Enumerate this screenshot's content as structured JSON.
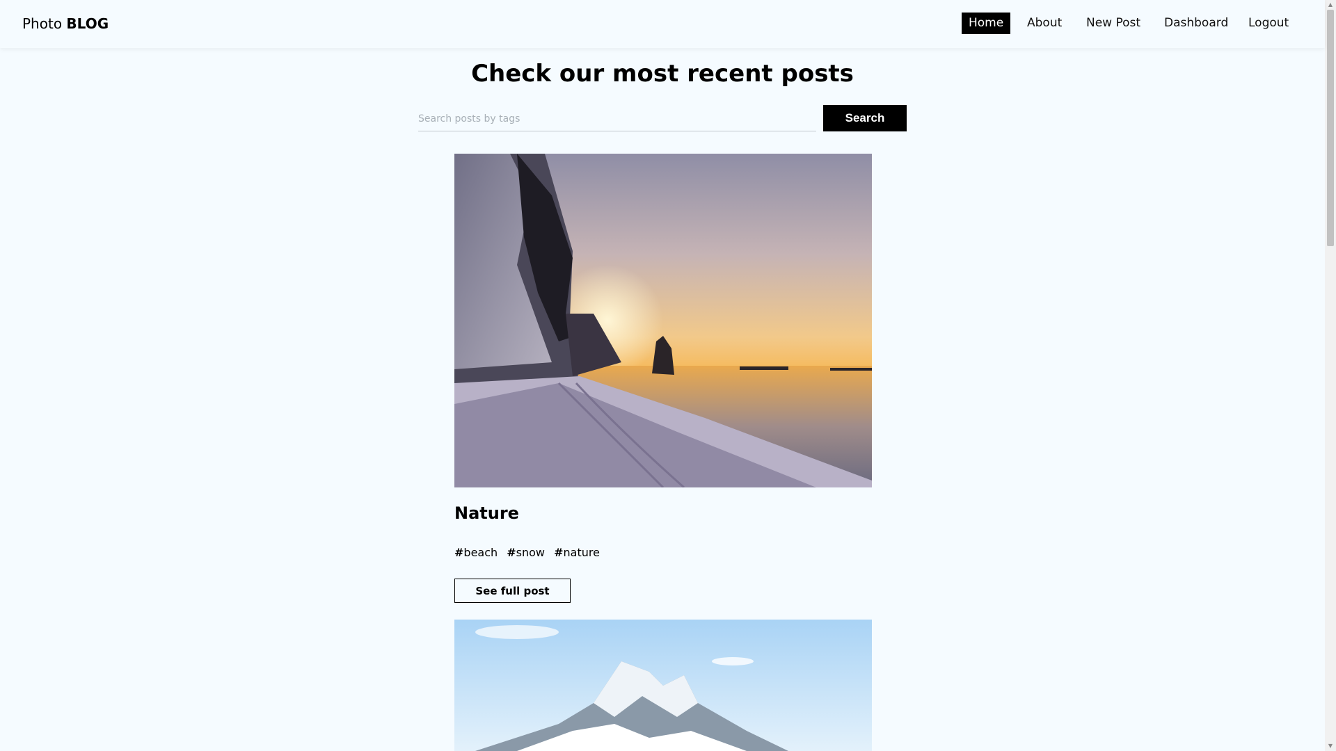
{
  "brand": {
    "prefix": "Photo",
    "bold": "BLOG"
  },
  "nav": {
    "items": [
      "Home",
      "About",
      "New Post",
      "Dashboard",
      "Logout"
    ],
    "active": "Home"
  },
  "heading": "Check our most recent posts",
  "search": {
    "placeholder": "Search posts by tags",
    "value": "",
    "button_label": "Search"
  },
  "posts": [
    {
      "title": "Nature",
      "tags": [
        "beach",
        "snow",
        "nature"
      ],
      "button_label": "See full post",
      "image": "snowy-beach-sunset-photo"
    },
    {
      "image": "snowy-mountain-photo"
    }
  ],
  "colors": {
    "background": "#f5fbff",
    "accent": "#000000"
  }
}
